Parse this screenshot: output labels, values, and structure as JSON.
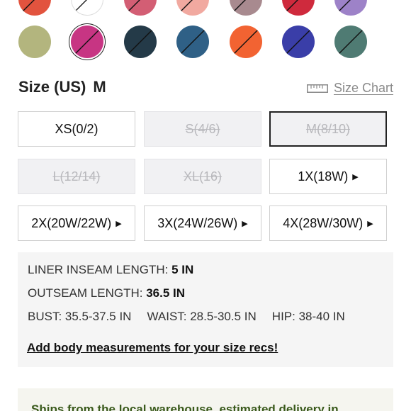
{
  "colors": {
    "row1": [
      {
        "name": "swatch-red-orange",
        "hex": "#e2533e",
        "unavailable": true
      },
      {
        "name": "swatch-white",
        "hex": "#ffffff",
        "unavailable": true
      },
      {
        "name": "swatch-rose",
        "hex": "#d35e74",
        "unavailable": true
      },
      {
        "name": "swatch-peach",
        "hex": "#f1a9a0",
        "unavailable": true
      },
      {
        "name": "swatch-mauve",
        "hex": "#a88a8f",
        "unavailable": true
      },
      {
        "name": "swatch-crimson",
        "hex": "#cf2a3d",
        "unavailable": true
      },
      {
        "name": "swatch-lavender",
        "hex": "#9d82c8",
        "unavailable": true
      }
    ],
    "row2": [
      {
        "name": "swatch-sage",
        "hex": "#b3b57e",
        "unavailable": false
      },
      {
        "name": "swatch-magenta",
        "hex": "#c73583",
        "unavailable": true,
        "selected": true
      },
      {
        "name": "swatch-dark-slate",
        "hex": "#243a48",
        "unavailable": true
      },
      {
        "name": "swatch-steel-blue",
        "hex": "#2f6086",
        "unavailable": true
      },
      {
        "name": "swatch-orange",
        "hex": "#f26332",
        "unavailable": true
      },
      {
        "name": "swatch-royal-blue",
        "hex": "#3a3ea8",
        "unavailable": true
      },
      {
        "name": "swatch-teal",
        "hex": "#4f7b73",
        "unavailable": true
      }
    ]
  },
  "size": {
    "label": "Size (US)",
    "selected": "M",
    "chart_link": "Size Chart",
    "options": [
      {
        "label": "XS(0/2)",
        "state": "available",
        "more": false
      },
      {
        "label": "S(4/6)",
        "state": "disabled",
        "more": false
      },
      {
        "label": "M(8/10)",
        "state": "selected-disabled",
        "more": false
      },
      {
        "label": "L(12/14)",
        "state": "disabled",
        "more": false
      },
      {
        "label": "XL(16)",
        "state": "disabled",
        "more": false
      },
      {
        "label": "1X(18W)",
        "state": "available",
        "more": true
      },
      {
        "label": "2X(20W/22W)",
        "state": "available",
        "more": true
      },
      {
        "label": "3X(24W/26W)",
        "state": "available",
        "more": true
      },
      {
        "label": "4X(28W/30W)",
        "state": "available",
        "more": true
      }
    ]
  },
  "measurements": {
    "liner_label": "LINER INSEAM LENGTH:",
    "liner_value": "5 IN",
    "outseam_label": "OUTSEAM LENGTH:",
    "outseam_value": "36.5 IN",
    "bust": "BUST: 35.5-37.5 IN",
    "waist": "WAIST: 28.5-30.5 IN",
    "hip": "HIP: 38-40 IN",
    "link": "Add body measurements for your size recs!"
  },
  "shipping": {
    "text": "Ships from the local warehouse, estimated delivery in"
  }
}
